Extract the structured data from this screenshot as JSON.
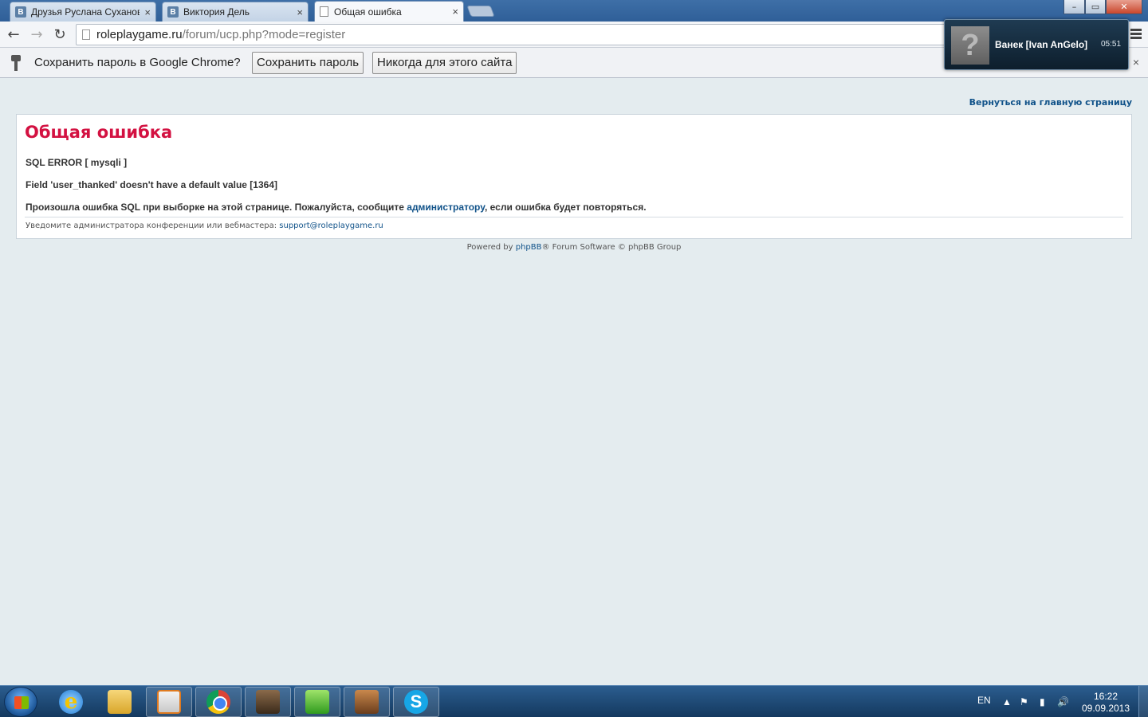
{
  "tabs": [
    {
      "label": "Друзья Руслана Сухановa",
      "favicon": "vk-icon",
      "close": "×"
    },
    {
      "label": "Виктория Дель",
      "favicon": "vk-icon",
      "close": "×"
    },
    {
      "label": "Общая ошибка",
      "favicon": "page-icon",
      "close": "×",
      "active": true
    }
  ],
  "favicon_letter": "B",
  "window_controls": {
    "minimize": "–",
    "maximize": "▭",
    "close": "✕"
  },
  "toolbar": {
    "back": "←",
    "forward": "→",
    "reload": "↻",
    "url_host": "roleplaygame.ru",
    "url_path": "/forum/ucp.php?mode=register"
  },
  "infobar": {
    "message": "Сохранить пароль в Google Chrome?",
    "save_label": "Сохранить пароль",
    "never_label": "Никогда для этого сайта",
    "close": "×"
  },
  "notification": {
    "avatar_glyph": "?",
    "name": "Ванек [Ivan AnGelo]",
    "time": "05:51"
  },
  "page": {
    "back_link": "Вернуться на главную страницу",
    "title": "Общая ошибка",
    "sql_error": "SQL ERROR [ mysqli ]",
    "field_error": "Field 'user_thanked' doesn't have a default value [1364]",
    "message_prefix": "Произошла ошибка SQL при выборке на этой странице. Пожалуйста, сообщите ",
    "message_link": "администратору",
    "message_suffix": ", если ошибка будет повторяться.",
    "notice_prefix": "Уведомите администратора конференции или вебмастера: ",
    "notice_email": "support@roleplaygame.ru",
    "powered_prefix": "Powered by ",
    "powered_link": "phpBB",
    "powered_suffix": "® Forum Software © phpBB Group"
  },
  "taskbar": {
    "ie_glyph": "e",
    "skype_glyph": "S",
    "lang": "EN",
    "tray_up": "▲",
    "tray_flag": "⚑",
    "tray_signal": "▮",
    "tray_volume": "🔊",
    "time": "16:22",
    "date": "09.09.2013"
  },
  "colors": {
    "error_title": "#d31141",
    "link": "#105289",
    "page_bg": "#e4ecef"
  }
}
